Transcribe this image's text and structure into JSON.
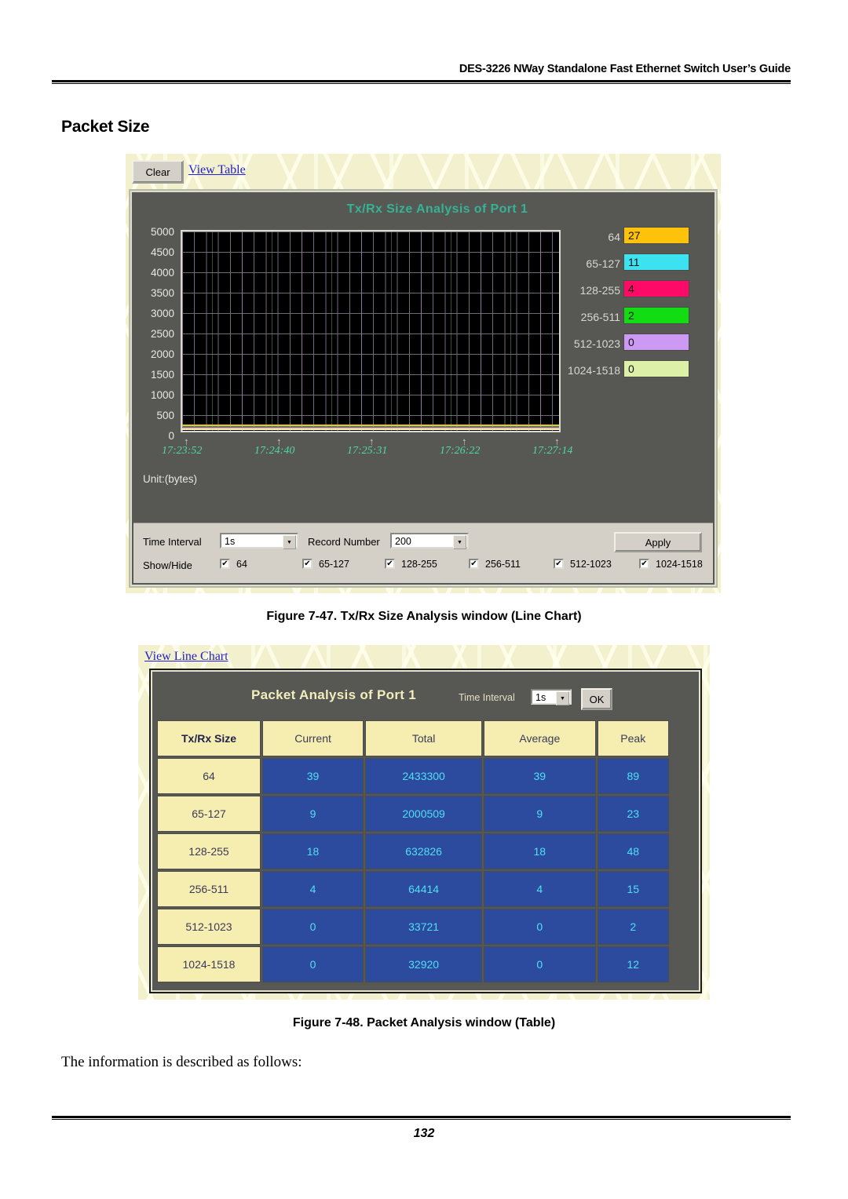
{
  "document": {
    "header": "DES-3226 NWay Standalone Fast Ethernet Switch User’s Guide",
    "section_title": "Packet Size",
    "figure1_caption": "Figure 7-47.  Tx/Rx Size Analysis window (Line Chart)",
    "figure2_caption": "Figure 7-48.  Packet Analysis window (Table)",
    "body_text": "The information is described as follows:",
    "page_number": "132"
  },
  "line_chart_window": {
    "toolbar": {
      "clear_label": "Clear",
      "view_table_link": "View Table"
    },
    "chart_title": "Tx/Rx Size Analysis of Port 1",
    "unit_label": "Unit:(bytes)",
    "controls": {
      "time_interval_label": "Time Interval",
      "time_interval_value": "1s",
      "record_number_label": "Record Number",
      "record_number_value": "200",
      "apply_label": "Apply",
      "show_hide_label": "Show/Hide",
      "show_hide_items": [
        {
          "label": "64",
          "checked": true
        },
        {
          "label": "65-127",
          "checked": true
        },
        {
          "label": "128-255",
          "checked": true
        },
        {
          "label": "256-511",
          "checked": true
        },
        {
          "label": "512-1023",
          "checked": true
        },
        {
          "label": "1024-1518",
          "checked": true
        }
      ]
    }
  },
  "chart_data": {
    "type": "line",
    "title": "Tx/Rx Size Analysis of Port 1",
    "xlabel": "",
    "ylabel": "Unit:(bytes)",
    "ylim": [
      0,
      5000
    ],
    "yticks": [
      "5000",
      "4500",
      "4000",
      "3500",
      "3000",
      "2500",
      "2000",
      "1500",
      "1000",
      "500",
      "0"
    ],
    "xticks": [
      "17:23:52",
      "17:24:40",
      "17:25:31",
      "17:26:22",
      "17:27:14"
    ],
    "grid": true,
    "legend_position": "right",
    "series": [
      {
        "name": "64",
        "current_value": "27",
        "color": "#ffc20a"
      },
      {
        "name": "65-127",
        "current_value": "11",
        "color": "#3de2f0"
      },
      {
        "name": "128-255",
        "current_value": "4",
        "color": "#ff0a66"
      },
      {
        "name": "256-511",
        "current_value": "2",
        "color": "#12dd12"
      },
      {
        "name": "512-1023",
        "current_value": "0",
        "color": "#cc9af2"
      },
      {
        "name": "1024-1518",
        "current_value": "0",
        "color": "#ddf0a8"
      }
    ]
  },
  "table_window": {
    "view_line_chart_link": "View Line Chart",
    "title": "Packet Analysis of Port 1",
    "time_interval_label": "Time Interval",
    "time_interval_value": "1s",
    "ok_label": "OK",
    "columns": [
      "Tx/Rx Size",
      "Current",
      "Total",
      "Average",
      "Peak"
    ],
    "rows": [
      {
        "size": "64",
        "current": "39",
        "total": "2433300",
        "average": "39",
        "peak": "89"
      },
      {
        "size": "65-127",
        "current": "9",
        "total": "2000509",
        "average": "9",
        "peak": "23"
      },
      {
        "size": "128-255",
        "current": "18",
        "total": "632826",
        "average": "18",
        "peak": "48"
      },
      {
        "size": "256-511",
        "current": "4",
        "total": "64414",
        "average": "4",
        "peak": "15"
      },
      {
        "size": "512-1023",
        "current": "0",
        "total": "33721",
        "average": "0",
        "peak": "2"
      },
      {
        "size": "1024-1518",
        "current": "0",
        "total": "32920",
        "average": "0",
        "peak": "12"
      }
    ]
  }
}
